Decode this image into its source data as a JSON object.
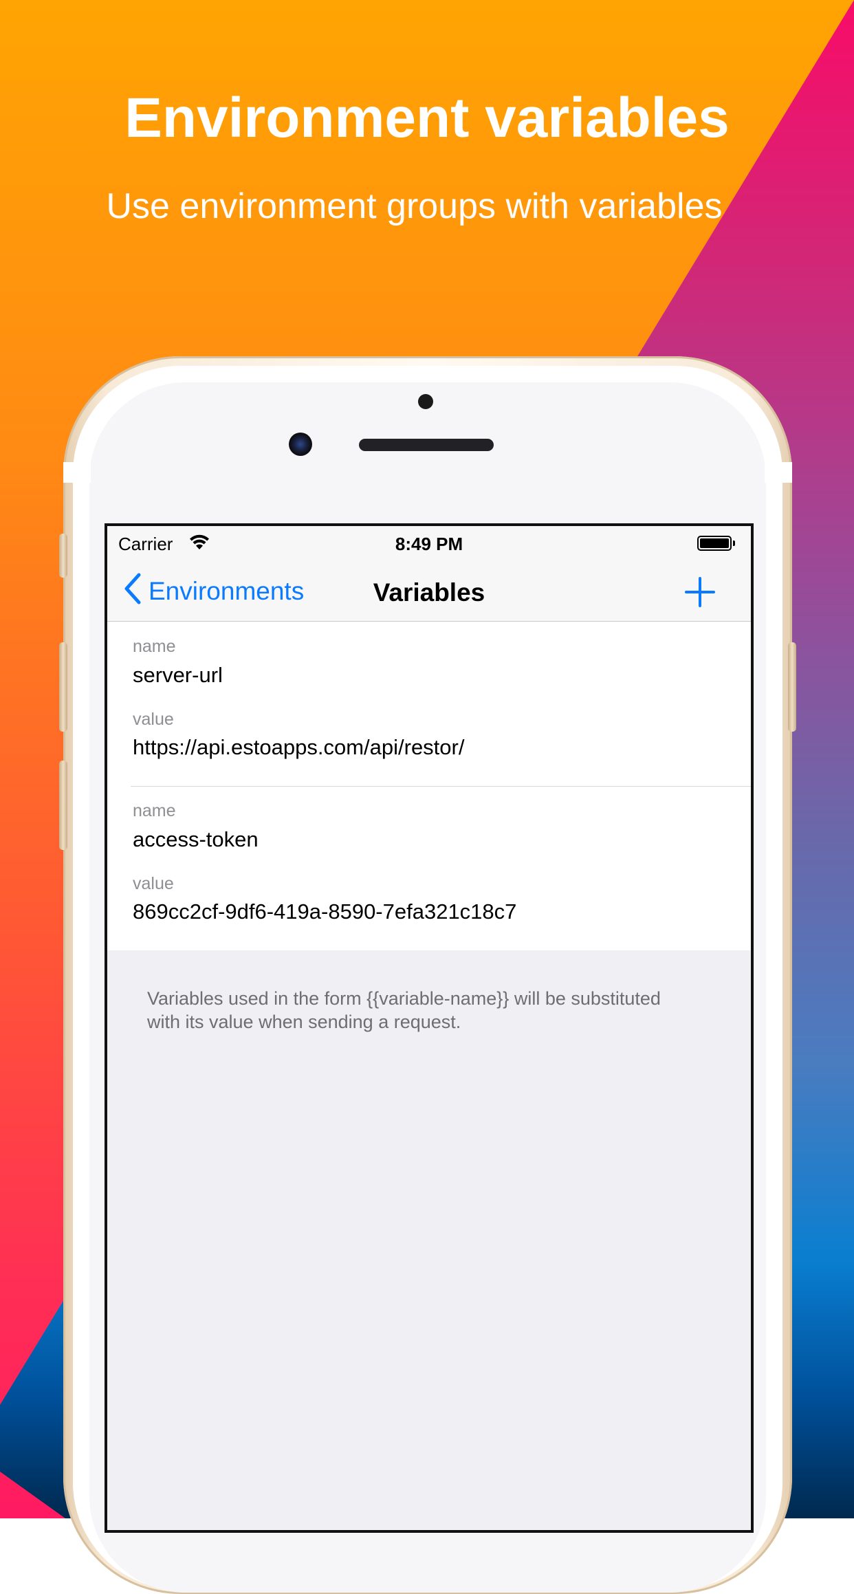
{
  "marketing": {
    "headline": "Environment variables",
    "subheadline": "Use environment groups with variables"
  },
  "status_bar": {
    "carrier": "Carrier",
    "time": "8:49 PM",
    "wifi_icon": "wifi-icon",
    "battery_icon": "battery-icon",
    "battery_level": 1.0
  },
  "nav": {
    "back_label": "Environments",
    "back_icon": "chevron-left-icon",
    "title": "Variables",
    "add_icon": "plus-icon"
  },
  "variables": [
    {
      "name_label": "name",
      "name": "server-url",
      "value_label": "value",
      "value": "https://api.estoapps.com/api/restor/"
    },
    {
      "name_label": "name",
      "name": "access-token",
      "value_label": "value",
      "value": "869cc2cf-9df6-419a-8590-7efa321c18c7"
    }
  ],
  "footer": {
    "note": "Variables used in the form {{variable-name}} will be substituted with its value when sending a request."
  },
  "colors": {
    "accent": "#0a7aff",
    "background_orange": "#ffa402",
    "background_pink": "#f80c68",
    "background_blue": "#0a7ed0"
  }
}
